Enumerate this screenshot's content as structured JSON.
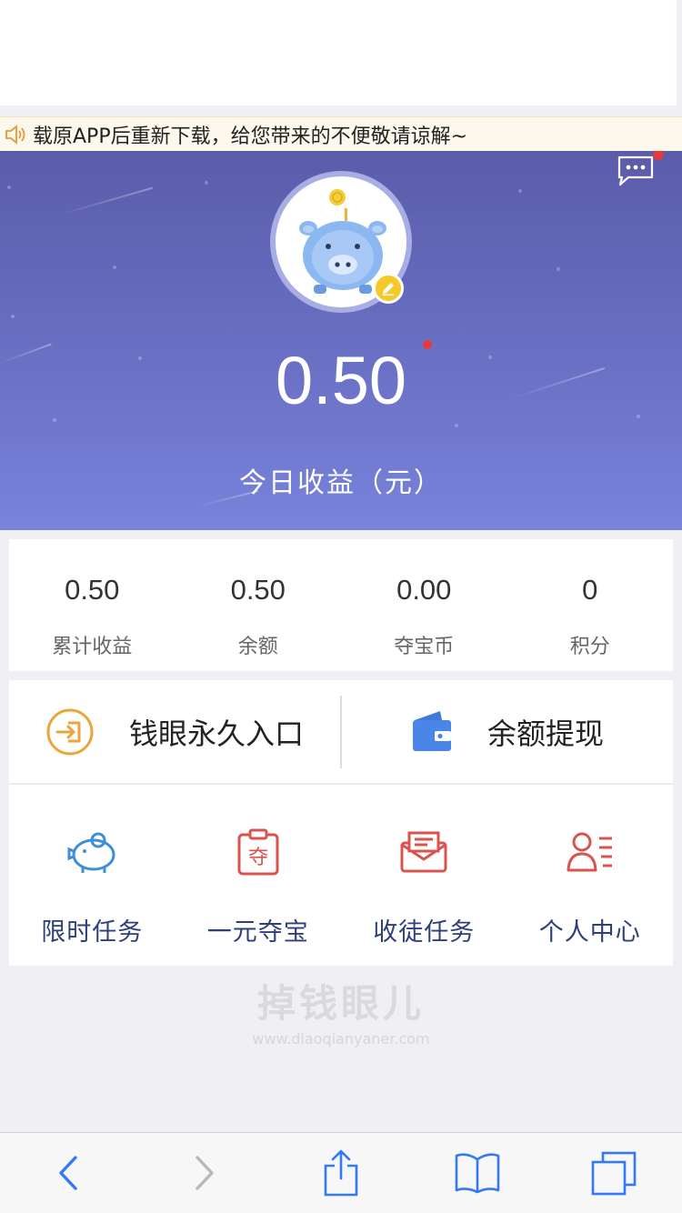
{
  "notice": {
    "text": "载原APP后重新下载，给您带来的不便敬请谅解~",
    "icon": "speaker-icon"
  },
  "hero": {
    "amount": "0.50",
    "label": "今日收益（元）",
    "chat_icon": "chat-icon",
    "avatar_icon": "piggy-bank-icon",
    "edit_icon": "pencil-icon"
  },
  "stats": [
    {
      "value": "0.50",
      "label": "累计收益"
    },
    {
      "value": "0.50",
      "label": "余额"
    },
    {
      "value": "0.00",
      "label": "夺宝币"
    },
    {
      "value": "0",
      "label": "积分"
    }
  ],
  "actions": [
    {
      "label": "钱眼永久入口",
      "icon": "enter-icon",
      "color": "#eba63a"
    },
    {
      "label": "余额提现",
      "icon": "wallet-icon",
      "color": "#4a86e8"
    }
  ],
  "grid": [
    {
      "label": "限时任务",
      "icon": "piggy-icon",
      "color": "#3f8fd6"
    },
    {
      "label": "一元夺宝",
      "icon": "clipboard-icon",
      "color": "#d9534f"
    },
    {
      "label": "收徒任务",
      "icon": "envelope-icon",
      "color": "#d9534f"
    },
    {
      "label": "个人中心",
      "icon": "profile-card-icon",
      "color": "#d9534f"
    }
  ],
  "watermark": {
    "logo": "掉钱眼儿",
    "url": "www.diaoqianyaner.com"
  },
  "toolbar": {
    "back_icon": "back-arrow-icon",
    "forward_icon": "forward-arrow-icon",
    "share_icon": "share-icon",
    "bookmarks_icon": "book-icon",
    "tabs_icon": "tabs-icon"
  },
  "colors": {
    "hero_top": "#5b5caa",
    "hero_bottom": "#7883db",
    "grid_label": "#2e3f7a",
    "badge_red": "#e53a3a"
  }
}
